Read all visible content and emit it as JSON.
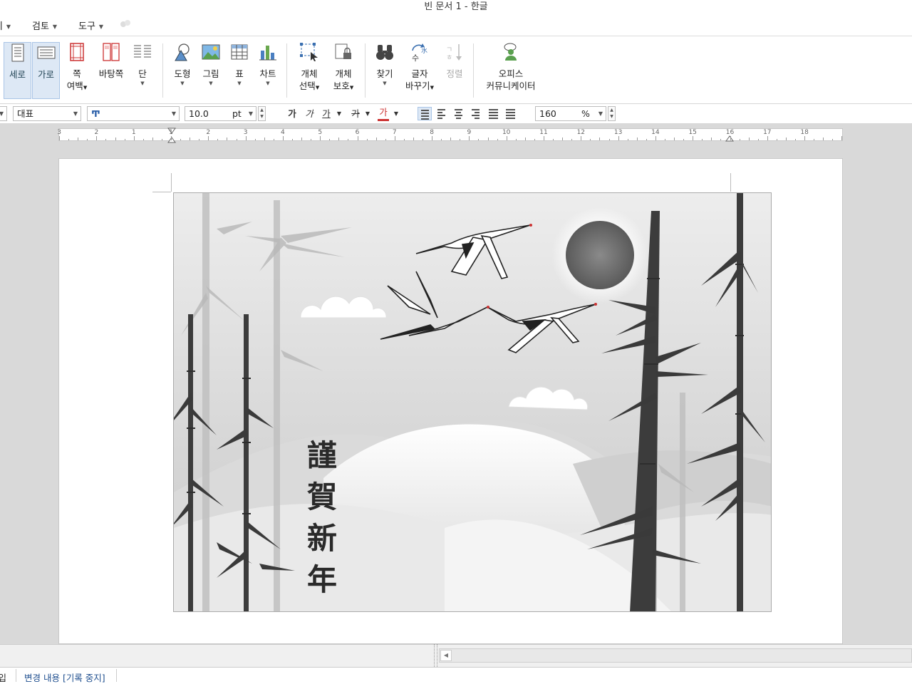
{
  "window": {
    "title": "빈 문서 1 - 한글"
  },
  "menu": [
    {
      "label": "보기"
    },
    {
      "label": "검토"
    },
    {
      "label": "도구"
    }
  ],
  "ribbon": {
    "portrait": {
      "label": "세로"
    },
    "landscape": {
      "label": "가로"
    },
    "margin": {
      "label1": "쪽",
      "label2": "여백"
    },
    "background": {
      "label": "바탕쪽"
    },
    "columns": {
      "label": "단"
    },
    "shape": {
      "label": "도형"
    },
    "picture": {
      "label": "그림"
    },
    "table": {
      "label": "표"
    },
    "chart": {
      "label": "차트"
    },
    "object_select": {
      "label1": "개체",
      "label2": "선택"
    },
    "object_protect": {
      "label1": "개체",
      "label2": "보호"
    },
    "find": {
      "label": "찾기"
    },
    "replace": {
      "label1": "글자",
      "label2": "바꾸기"
    },
    "sort": {
      "label": "정렬"
    },
    "communicator": {
      "label1": "오피스",
      "label2": "커뮤니케이터"
    }
  },
  "format": {
    "style": "대표",
    "font_icon": "Ͳ",
    "size": "10.0",
    "unit": "pt",
    "bold": "가",
    "italic": "가",
    "underline": "가",
    "strike": "가",
    "color": "가",
    "zoom": "160",
    "zoom_unit": "%"
  },
  "ruler": {
    "numbers": [
      "3",
      "2",
      "1",
      "1",
      "2",
      "3",
      "4",
      "5",
      "6",
      "7",
      "8",
      "9",
      "10",
      "11",
      "12",
      "13",
      "14",
      "15",
      "16",
      "17",
      "18"
    ]
  },
  "document": {
    "calligraphy": [
      "謹",
      "賀",
      "新",
      "年"
    ]
  },
  "status": {
    "insert": "삽입",
    "track_changes": "변경 내용 [기록 중지]"
  },
  "colors": {
    "accent": "#dde8f5",
    "accent_border": "#a9c4e6"
  }
}
